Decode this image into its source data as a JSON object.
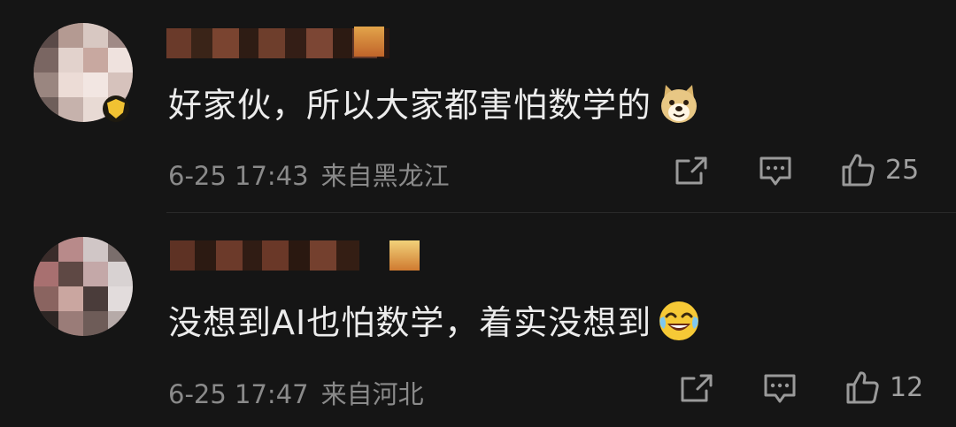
{
  "comments": [
    {
      "content": "好家伙，所以大家都害怕数学的",
      "emoji": "doge-emoji",
      "date": "6-25 17:43",
      "location": "来自黑龙江",
      "likes": "25"
    },
    {
      "content": "没想到AI也怕数学，着实没想到",
      "emoji": "laughing-crying-emoji",
      "date": "6-25 17:47",
      "location": "来自河北",
      "likes": "12"
    }
  ],
  "icons": {
    "share": "share-icon",
    "reply": "comment-icon",
    "like": "thumbs-up-icon"
  },
  "colors": {
    "background": "#151515",
    "content_text": "#ececec",
    "meta_text": "#8a8a8a",
    "verified_badge": "#f1c232"
  }
}
